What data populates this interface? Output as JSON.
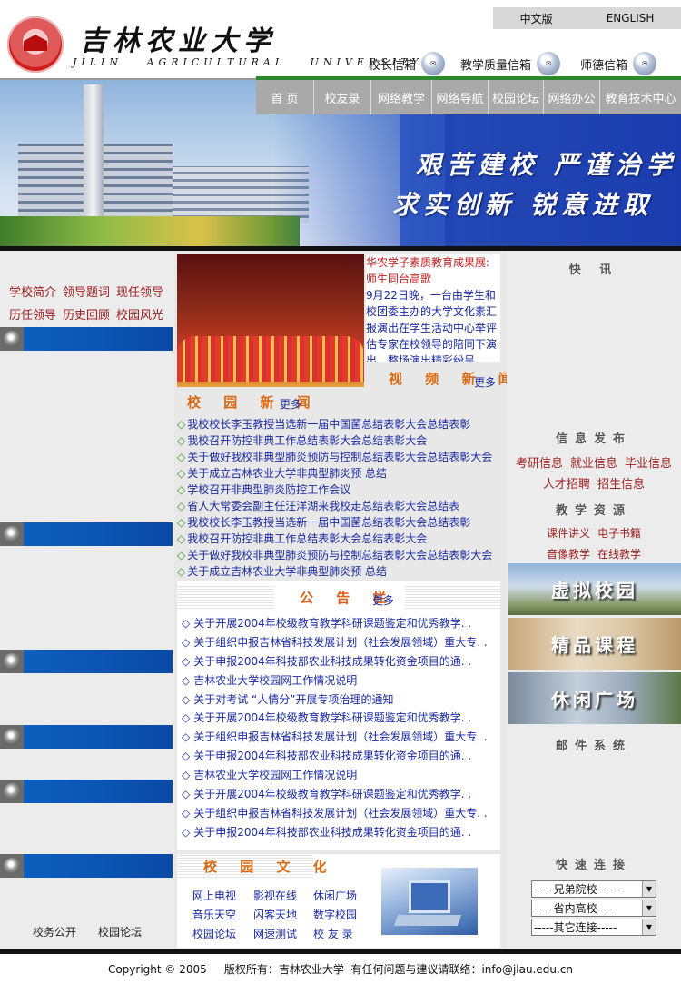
{
  "header": {
    "lang_cn": "中文版",
    "lang_en": "ENGLISH",
    "uni_name_cn": "吉林农业大学",
    "uni_name_en": "JILIN AGRICULTURAL UNIVERSITY",
    "mailboxes": [
      "校长信箱",
      "教学质量信箱",
      "师德信箱"
    ]
  },
  "nav": [
    "首  页",
    "校友录",
    "网络教学",
    "网络导航",
    "校园论坛",
    "网络办公",
    "教育技术中心"
  ],
  "banner": {
    "slogan_1": "艰苦建校   严谨治学",
    "slogan_2": "求实创新   锐意进取"
  },
  "left": {
    "links_row1": [
      "学校简介",
      "领导题词",
      "现任领导"
    ],
    "links_row2": [
      "历任领导",
      "历史回顾",
      "校园风光"
    ],
    "footer_links": [
      "校务公开",
      "校园论坛"
    ]
  },
  "video_news": {
    "headline": "华农学子素质教育成果展:师生同台高歌",
    "body": "9月22日晚，一台由学生和校团委主办的大学文化素汇报演出在学生活动中心举评估专家在校领导的陪同下演出。整场演出精彩纷呈，",
    "section_title": "视 频 新 闻",
    "more": "更多"
  },
  "campus_news": {
    "section_title": "校 园 新 闻",
    "more": "更多",
    "items": [
      "我校校长李玉教授当选新一届中国菌总结表彰大会总结表彰",
      "我校召开防控非典工作总结表彰大会总结表彰大会",
      "关于做好我校非典型肺炎预防与控制总结表彰大会总结表彰大会",
      "关于成立吉林农业大学非典型肺炎预 总结",
      "学校召开非典型肺炎防控工作会议",
      "省人大常委会副主任汪洋湖来我校走总结表彰大会总结表",
      "我校校长李玉教授当选新一届中国菌总结表彰大会总结表彰",
      "我校召开防控非典工作总结表彰大会总结表彰大会",
      "关于做好我校非典型肺炎预防与控制总结表彰大会总结表彰大会",
      "关于成立吉林农业大学非典型肺炎预 总结"
    ]
  },
  "notice": {
    "section_title": "公 告 栏",
    "more": "更多",
    "items": [
      "关于开展2004年校级教育教学科研课题鉴定和优秀教学. .",
      "关于组织申报吉林省科技发展计划（社会发展领域）重大专. .",
      "关于申报2004年科技部农业科技成果转化资金项目的通. .",
      "吉林农业大学校园网工作情况说明",
      "关于对考试 “人情分”开展专项治理的通知",
      "关于开展2004年校级教育教学科研课题鉴定和优秀教学. .",
      "关于组织申报吉林省科技发展计划（社会发展领域）重大专. .",
      "关于申报2004年科技部农业科技成果转化资金项目的通. .",
      "吉林农业大学校园网工作情况说明",
      "关于开展2004年校级教育教学科研课题鉴定和优秀教学. .",
      "关于组织申报吉林省科技发展计划（社会发展领域）重大专. .",
      "关于申报2004年科技部农业科技成果转化资金项目的通. ."
    ]
  },
  "culture": {
    "section_title": "校 园 文 化",
    "links": [
      "网上电视",
      "影视在线",
      "休闲广场",
      "音乐天空",
      "闪客天地",
      "数字校园",
      "校园论坛",
      "网速测试",
      "校 友 录"
    ]
  },
  "right": {
    "head_1": "快 讯",
    "head_2": "信息发布",
    "info_row1": [
      "考研信息",
      "就业信息",
      "毕业信息"
    ],
    "info_row2": [
      "人才招聘",
      "招生信息"
    ],
    "head_3": "教学资源",
    "res_row1": [
      "课件讲义",
      "电子书籍"
    ],
    "res_row2": [
      "音像教学",
      "在线教学"
    ],
    "promos": [
      "虚拟校园",
      "精品课程",
      "休闲广场"
    ],
    "head_4": "邮件系统",
    "head_5": "快速连接",
    "selects": [
      "-----兄弟院校------",
      "-----省内高校-----",
      "-----其它连接-----"
    ]
  },
  "footer": {
    "copyright": "Copyright © 2005     版权所有：吉林农业大学  有任何问题与建议请联络：info@jlau.edu.cn"
  }
}
